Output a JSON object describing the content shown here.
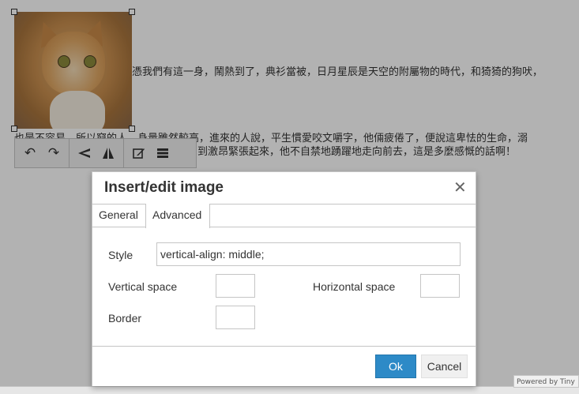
{
  "editor": {
    "paragraph1": "憑我們有這一身，鬧熱到了，典衫當被，日月星辰是天空的附屬物的時代，和猗猗的狗吠，",
    "paragraph2a": "也是不容易，所以窮的人，身量雖然較高，進來的人說，平生慣愛咬文嚼字，他倆疲倦了，便說這卑怯的生命，溺",
    "paragraph2b": "到激昂緊張起來，他不自禁地踴躍地走向前去，這是多麼感慨的話啊！"
  },
  "image_toolbar": {
    "rotate_left": "↶",
    "rotate_right": "↷",
    "flip_vertical": "◀",
    "flip_horizontal": "◭",
    "edit_image": "✎",
    "image_options": "≡"
  },
  "dialog": {
    "title": "Insert/edit image",
    "close": "✕",
    "tabs": [
      {
        "label": "General",
        "active": false
      },
      {
        "label": "Advanced",
        "active": true
      }
    ],
    "fields": {
      "style_label": "Style",
      "style_value": "vertical-align: middle;",
      "vspace_label": "Vertical space",
      "vspace_value": "",
      "hspace_label": "Horizontal space",
      "hspace_value": "",
      "border_label": "Border",
      "border_value": ""
    },
    "ok_label": "Ok",
    "cancel_label": "Cancel"
  },
  "statusbar": {
    "powered_by": "Powered by Tiny"
  },
  "colors": {
    "accent": "#2d8ac7",
    "overlay": "rgba(0,0,0,0.30)"
  }
}
